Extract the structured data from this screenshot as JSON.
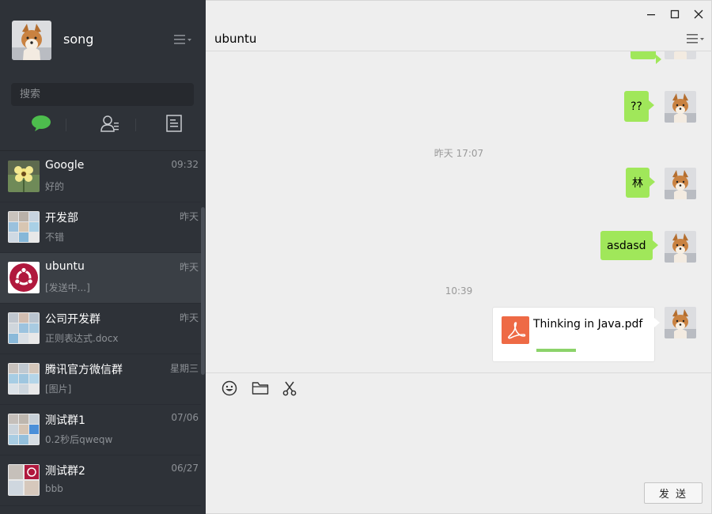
{
  "profile": {
    "name": "song",
    "avatar": "shiba-dog-avatar"
  },
  "search": {
    "placeholder": "搜索"
  },
  "nav": {
    "icons": [
      "chat-icon",
      "contacts-icon",
      "favorites-icon"
    ],
    "active_color": "#4dbd4d"
  },
  "conversations": [
    {
      "name": "Google",
      "time": "09:32",
      "preview": "好的",
      "avatar": "flower-avatar"
    },
    {
      "name": "开发部",
      "time": "昨天",
      "preview": "不错",
      "avatar": "group-avatar"
    },
    {
      "name": "ubuntu",
      "time": "昨天",
      "preview": "[发送中...]",
      "avatar": "ubuntu-avatar",
      "active": true
    },
    {
      "name": "公司开发群",
      "time": "昨天",
      "preview": "正则表达式.docx",
      "avatar": "group-avatar"
    },
    {
      "name": "腾讯官方微信群",
      "time": "星期三",
      "preview": "[图片]",
      "avatar": "group-avatar"
    },
    {
      "name": "测试群1",
      "time": "07/06",
      "preview": "0.2秒后qweqw",
      "avatar": "group-avatar"
    },
    {
      "name": "测试群2",
      "time": "06/27",
      "preview": "bbb",
      "avatar": "group-avatar"
    }
  ],
  "chat": {
    "title": "ubuntu",
    "timestamps": [
      "昨天 17:07",
      "10:39"
    ],
    "messages": [
      "??",
      "林",
      "asdasd"
    ],
    "file": {
      "name": "Thinking in Java.pdf",
      "progress": 0.25
    }
  },
  "composer": {
    "send_label": "发 送"
  },
  "colors": {
    "sidebar": "#2e3238",
    "bubble": "#a0e75a",
    "pdf": "#ee6a45"
  }
}
